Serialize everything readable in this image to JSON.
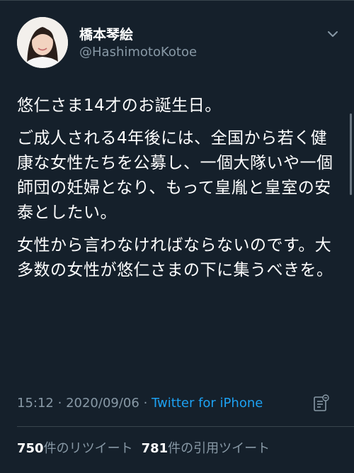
{
  "author": {
    "display_name": "橋本琴絵",
    "handle": "@HashimotoKotoe"
  },
  "tweet": {
    "paragraphs": [
      "悠仁さま14才のお誕生日。",
      "ご成人される4年後には、全国から若く健康な女性たちを公募し、一個大隊いや一個師団の妊婦となり、もって皇胤と皇室の安泰としたい。",
      "女性から言わなければならないのです。大多数の女性が悠仁さまの下に集うべきを。"
    ]
  },
  "meta": {
    "time": "15:12",
    "separator": "·",
    "date": "2020/09/06",
    "source": "Twitter for iPhone"
  },
  "stats": {
    "retweets_count": "750",
    "retweets_label": "件のリツイート",
    "quotes_count": "781",
    "quotes_label": "件の引用ツイート"
  },
  "icons": {
    "chevron": "chevron-down-icon",
    "analytics": "analytics-icon"
  },
  "colors": {
    "background": "#15202b",
    "text": "#ffffff",
    "secondary": "#8899a6",
    "link": "#1da1f2"
  }
}
